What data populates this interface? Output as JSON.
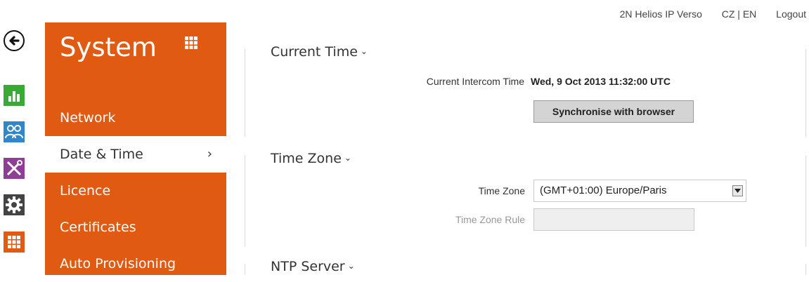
{
  "topbar": {
    "device": "2N Helios IP Verso",
    "language": "CZ | EN",
    "logout": "Logout"
  },
  "iconbar": {
    "items": [
      {
        "icon": "back-arrow-icon"
      },
      {
        "icon": "bar-chart-icon",
        "color": "#3aa935"
      },
      {
        "icon": "users-icon",
        "color": "#2f86c9"
      },
      {
        "icon": "tools-icon",
        "color": "#8e3f95"
      },
      {
        "icon": "gear-icon",
        "color": "#444444"
      },
      {
        "icon": "grid-icon",
        "color": "#e05a12"
      }
    ]
  },
  "menu": {
    "title": "System",
    "accent": "#e05a12",
    "items": [
      {
        "label": "Network"
      },
      {
        "label": "Date & Time",
        "active": true
      },
      {
        "label": "Licence"
      },
      {
        "label": "Certificates"
      },
      {
        "label": "Auto Provisioning"
      }
    ]
  },
  "sections": {
    "current_time": {
      "title": "Current Time",
      "label": "Current Intercom Time",
      "value": "Wed, 9 Oct 2013 11:32:00 UTC",
      "button": "Synchronise with browser"
    },
    "time_zone": {
      "title": "Time Zone",
      "tz_label": "Time Zone",
      "tz_value": "(GMT+01:00) Europe/Paris",
      "rule_label": "Time Zone Rule",
      "rule_value": ""
    },
    "ntp": {
      "title": "NTP Server"
    }
  }
}
